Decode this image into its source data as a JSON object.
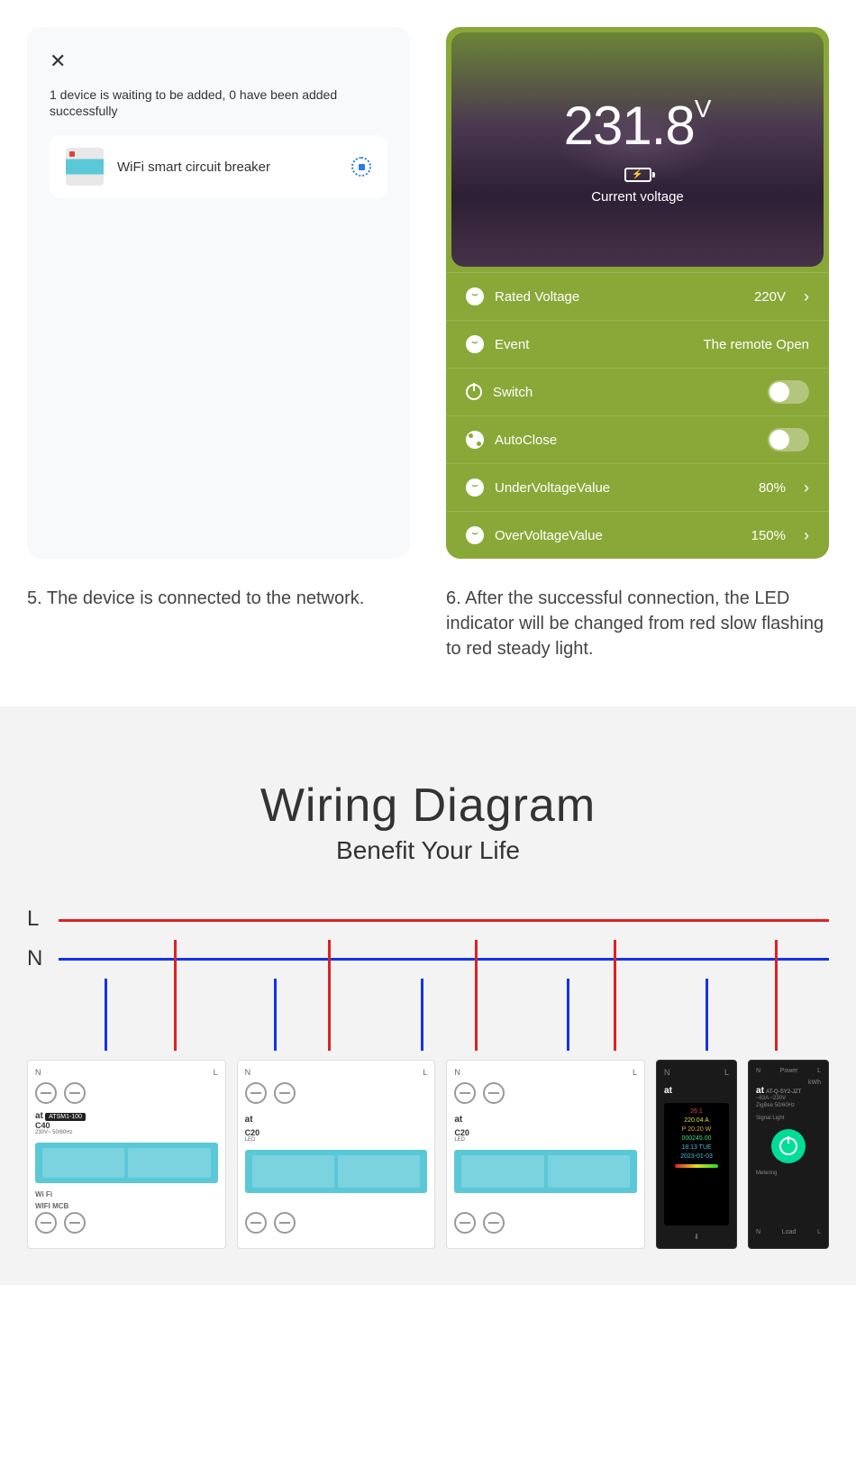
{
  "left": {
    "close": "✕",
    "waiting": "1 device is waiting to be added, 0 have been added successfully",
    "device_name": "WiFi smart circuit breaker"
  },
  "right": {
    "voltage": "231.8",
    "unit": "V",
    "cur_label": "Current voltage",
    "rows": {
      "rated_label": "Rated Voltage",
      "rated_val": "220V",
      "event_label": "Event",
      "event_val": "The remote Open",
      "switch_label": "Switch",
      "auto_label": "AutoClose",
      "under_label": "UnderVoltageValue",
      "under_val": "80%",
      "over_label": "OverVoltageValue",
      "over_val": "150%"
    }
  },
  "captions": {
    "c5": "5. The device is connected to the network.",
    "c6": "6. After the successful connection, the LED indicator will be changed from red slow flashing to red steady light."
  },
  "wiring": {
    "title": "Wiring Diagram",
    "subtitle": "Benefit Your Life",
    "L": "L",
    "N": "N"
  },
  "devices": {
    "d1": {
      "n": "N",
      "l": "L",
      "brand": "at",
      "model": "ATSM1-100",
      "code": "C40",
      "spec": "230V~  50/60Hz",
      "wifi": "WIFI MCB",
      "wifilogo": "Wi Fi"
    },
    "d2": {
      "n": "N",
      "l": "L",
      "brand": "at",
      "code": "C20",
      "led": "LED"
    },
    "d3": {
      "n": "N",
      "l": "L",
      "brand": "at",
      "code": "C20",
      "led": "LED"
    },
    "d4": {
      "n": "N",
      "l": "L",
      "brand": "at",
      "temp": "26.1",
      "v": "220.04  A",
      "p": "P 20.20  W",
      "e": "000245.00",
      "time": "18:13 TUE",
      "date": "2023-01-03"
    },
    "d5": {
      "n": "N",
      "power": "Power",
      "l": "L",
      "brand": "at",
      "model": "AT-Q-SY2-JZT",
      "amp": "~63A  ~230V",
      "proto": "ZigBee  50/60Hz",
      "sig": "Signal Light",
      "meter": "Metering",
      "kwh": "kWh",
      "load": "Load",
      "n2": "N",
      "l2": "L"
    }
  }
}
